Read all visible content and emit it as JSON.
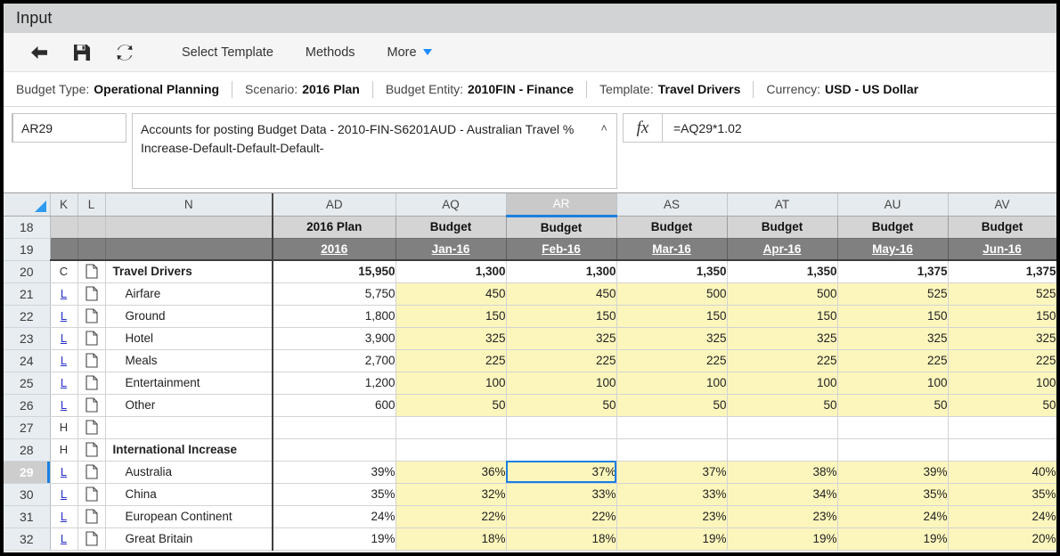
{
  "window": {
    "title": "Input"
  },
  "toolbar": {
    "icons": [
      {
        "name": "back-arrow-icon",
        "label": "Back"
      },
      {
        "name": "save-icon",
        "label": "Save"
      },
      {
        "name": "refresh-icon",
        "label": "Refresh"
      }
    ],
    "items": [
      {
        "label": "Select Template",
        "has_caret": false
      },
      {
        "label": "Methods",
        "has_caret": false
      },
      {
        "label": "More",
        "has_caret": true
      }
    ]
  },
  "context_bar": [
    {
      "label": "Budget Type:",
      "value": "Operational Planning"
    },
    {
      "label": "Scenario:",
      "value": "2016 Plan"
    },
    {
      "label": "Budget Entity:",
      "value": "2010FIN - Finance"
    },
    {
      "label": "Template:",
      "value": "Travel Drivers"
    },
    {
      "label": "Currency:",
      "value": "USD - US Dollar"
    }
  ],
  "formula_bar": {
    "name_box": "AR29",
    "description_line1": "Accounts for posting Budget Data - 2010-FIN-S6201AUD - Australian Travel",
    "description_line2": "% Increase-Default-Default-Default-",
    "collapse_icon": "˄",
    "fx_label": "fx",
    "formula": "=AQ29*1.02"
  },
  "grid": {
    "column_letters": [
      "K",
      "L",
      "N",
      "AD",
      "AQ",
      "AR",
      "AS",
      "AT",
      "AU",
      "AV"
    ],
    "selected_column": "AR",
    "selected_row": "29",
    "selected_cell": "AR29",
    "header_rows": [
      {
        "row": "18",
        "cells": [
          "2016 Plan",
          "Budget",
          "Budget",
          "Budget",
          "Budget",
          "Budget",
          "Budget"
        ]
      },
      {
        "row": "19",
        "cells": [
          "2016",
          "Jan-16",
          "Feb-16",
          "Mar-16",
          "Apr-16",
          "May-16",
          "Jun-16"
        ]
      }
    ],
    "rows": [
      {
        "row": "20",
        "k": "C",
        "k_link": false,
        "doc": true,
        "label": "Travel Drivers",
        "group": true,
        "values": [
          "15,950",
          "1,300",
          "1,300",
          "1,350",
          "1,350",
          "1,375",
          "1,375"
        ],
        "bold": true,
        "yellow": false
      },
      {
        "row": "21",
        "k": "L",
        "k_link": true,
        "doc": true,
        "label": "Airfare",
        "group": false,
        "values": [
          "5,750",
          "450",
          "450",
          "500",
          "500",
          "525",
          "525"
        ],
        "bold": false,
        "yellow": true
      },
      {
        "row": "22",
        "k": "L",
        "k_link": true,
        "doc": true,
        "label": "Ground",
        "group": false,
        "values": [
          "1,800",
          "150",
          "150",
          "150",
          "150",
          "150",
          "150"
        ],
        "bold": false,
        "yellow": true
      },
      {
        "row": "23",
        "k": "L",
        "k_link": true,
        "doc": true,
        "label": "Hotel",
        "group": false,
        "values": [
          "3,900",
          "325",
          "325",
          "325",
          "325",
          "325",
          "325"
        ],
        "bold": false,
        "yellow": true
      },
      {
        "row": "24",
        "k": "L",
        "k_link": true,
        "doc": true,
        "label": "Meals",
        "group": false,
        "values": [
          "2,700",
          "225",
          "225",
          "225",
          "225",
          "225",
          "225"
        ],
        "bold": false,
        "yellow": true
      },
      {
        "row": "25",
        "k": "L",
        "k_link": true,
        "doc": true,
        "label": "Entertainment",
        "group": false,
        "values": [
          "1,200",
          "100",
          "100",
          "100",
          "100",
          "100",
          "100"
        ],
        "bold": false,
        "yellow": true
      },
      {
        "row": "26",
        "k": "L",
        "k_link": true,
        "doc": true,
        "label": "Other",
        "group": false,
        "values": [
          "600",
          "50",
          "50",
          "50",
          "50",
          "50",
          "50"
        ],
        "bold": false,
        "yellow": true
      },
      {
        "row": "27",
        "k": "H",
        "k_link": false,
        "doc": true,
        "label": "",
        "group": false,
        "values": [
          "",
          "",
          "",
          "",
          "",
          "",
          ""
        ],
        "bold": false,
        "yellow": false
      },
      {
        "row": "28",
        "k": "H",
        "k_link": false,
        "doc": true,
        "label": "International Increase",
        "group": true,
        "values": [
          "",
          "",
          "",
          "",
          "",
          "",
          ""
        ],
        "bold": false,
        "yellow": false
      },
      {
        "row": "29",
        "k": "L",
        "k_link": true,
        "doc": true,
        "label": "Australia",
        "group": false,
        "values": [
          "39%",
          "36%",
          "37%",
          "37%",
          "38%",
          "39%",
          "40%"
        ],
        "bold": false,
        "yellow": true
      },
      {
        "row": "30",
        "k": "L",
        "k_link": true,
        "doc": true,
        "label": "China",
        "group": false,
        "values": [
          "35%",
          "32%",
          "33%",
          "33%",
          "34%",
          "35%",
          "35%"
        ],
        "bold": false,
        "yellow": true
      },
      {
        "row": "31",
        "k": "L",
        "k_link": true,
        "doc": true,
        "label": "European Continent",
        "group": false,
        "values": [
          "24%",
          "22%",
          "22%",
          "23%",
          "23%",
          "24%",
          "24%"
        ],
        "bold": false,
        "yellow": true
      },
      {
        "row": "32",
        "k": "L",
        "k_link": true,
        "doc": true,
        "label": "Great Britain",
        "group": false,
        "values": [
          "19%",
          "18%",
          "18%",
          "19%",
          "19%",
          "19%",
          "20%"
        ],
        "bold": false,
        "yellow": true
      }
    ]
  },
  "colors": {
    "accent_blue": "#1a7fe0",
    "input_yellow": "#fcf6bc",
    "titlebar_gray": "#d1d3d4",
    "band18_gray": "#d4d4d4",
    "band19_gray": "#808080",
    "link_blue": "#2730c8"
  }
}
